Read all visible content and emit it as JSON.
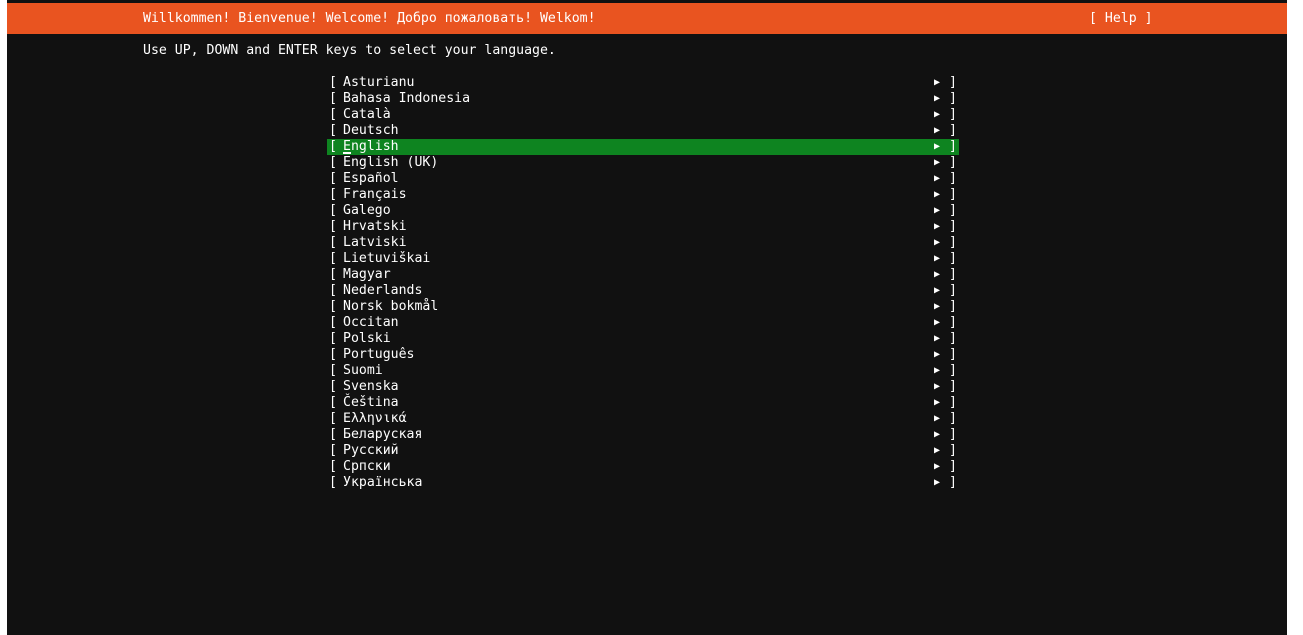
{
  "header": {
    "title": "Willkommen! Bienvenue! Welcome! Добро пожаловать! Welkom!",
    "help_label": "[ Help ]"
  },
  "instructions": "Use UP, DOWN and ENTER keys to select your language.",
  "bracket_open": "[",
  "bracket_close": "]",
  "arrow_glyph": "▶",
  "selected_index": 4,
  "colors": {
    "header_bg": "#e95420",
    "selected_bg": "#0e8420",
    "screen_bg": "#111111",
    "text": "#ffffff"
  },
  "languages": [
    "Asturianu",
    "Bahasa Indonesia",
    "Català",
    "Deutsch",
    "English",
    "English (UK)",
    "Español",
    "Français",
    "Galego",
    "Hrvatski",
    "Latviski",
    "Lietuviškai",
    "Magyar",
    "Nederlands",
    "Norsk bokmål",
    "Occitan",
    "Polski",
    "Português",
    "Suomi",
    "Svenska",
    "Čeština",
    "Ελληνικά",
    "Беларуская",
    "Русский",
    "Српски",
    "Українська"
  ]
}
